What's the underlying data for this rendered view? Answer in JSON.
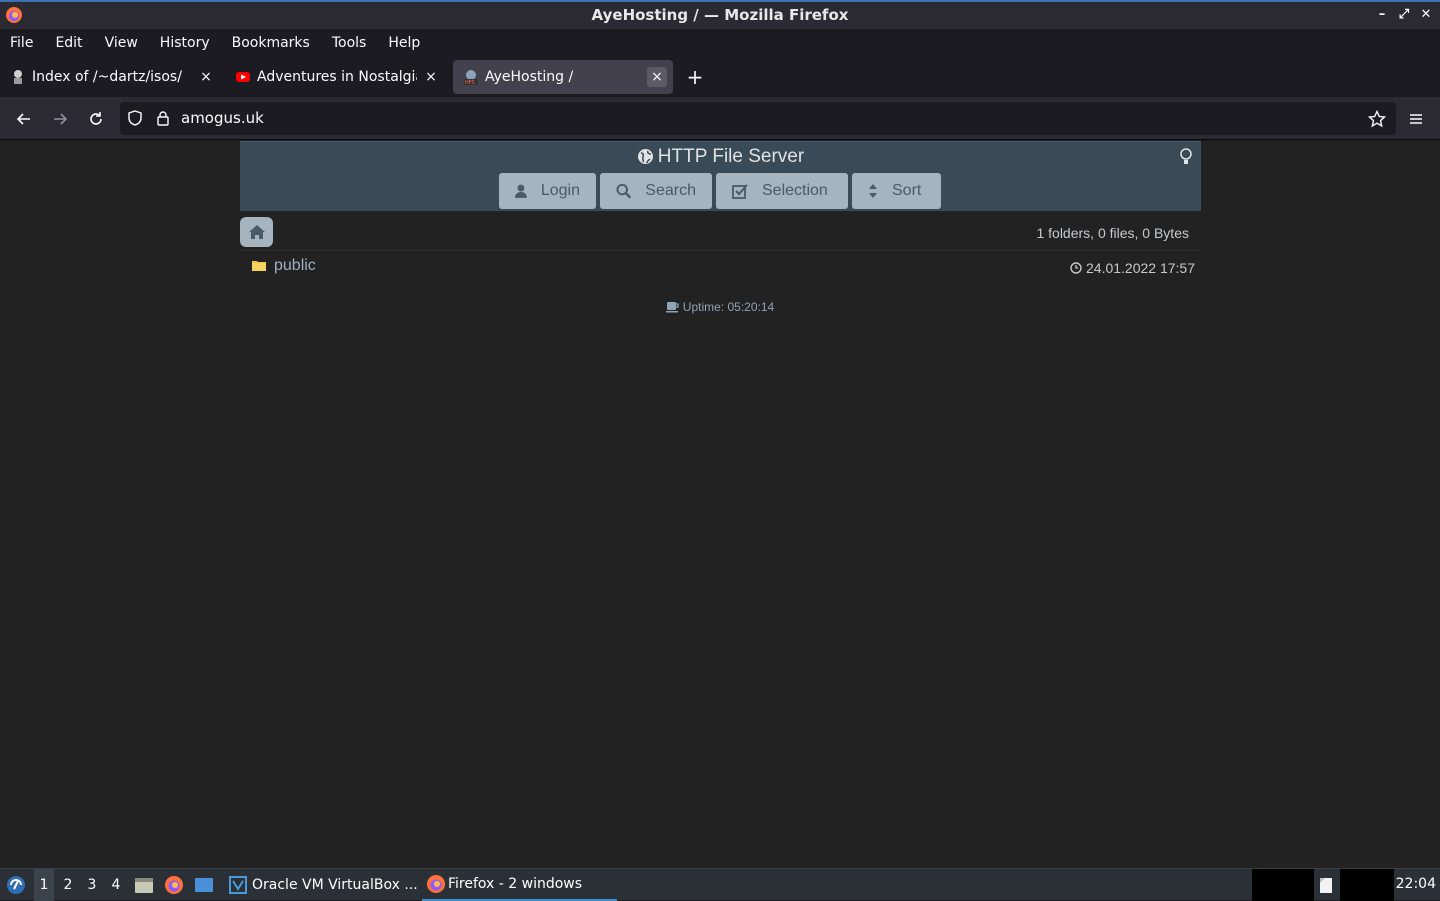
{
  "window": {
    "title": "AyeHosting / — Mozilla Firefox"
  },
  "menubar": [
    "File",
    "Edit",
    "View",
    "History",
    "Bookmarks",
    "Tools",
    "Help"
  ],
  "tabs": [
    {
      "label": "Index of /~dartz/isos/",
      "icon": "server-favicon",
      "active": false
    },
    {
      "label": "Adventures in Nostalgia",
      "icon": "youtube-favicon",
      "active": false
    },
    {
      "label": "AyeHosting /",
      "icon": "hfs-favicon",
      "active": true
    }
  ],
  "navbar": {
    "url": "amogus.uk"
  },
  "hfs": {
    "title": "HTTP File Server",
    "buttons": {
      "login": "Login",
      "search": "Search",
      "selection": "Selection",
      "sort": "Sort"
    },
    "folder_stats": "1 folders, 0 files, 0 Bytes",
    "files": [
      {
        "name": "public",
        "date": "24.01.2022 17:57"
      }
    ],
    "uptime": "Uptime: 05:20:14"
  },
  "taskbar": {
    "workspaces": [
      "1",
      "2",
      "3",
      "4"
    ],
    "tasks": [
      {
        "label": "Oracle VM VirtualBox ...",
        "active": false
      },
      {
        "label": "Firefox - 2 windows",
        "active": true
      }
    ],
    "clock": "22:04"
  },
  "colors": {
    "accent": "#3d8fd1",
    "hfs_header": "#3a4a56",
    "hfs_button": "#a6b4bf",
    "page_bg": "#222222"
  }
}
